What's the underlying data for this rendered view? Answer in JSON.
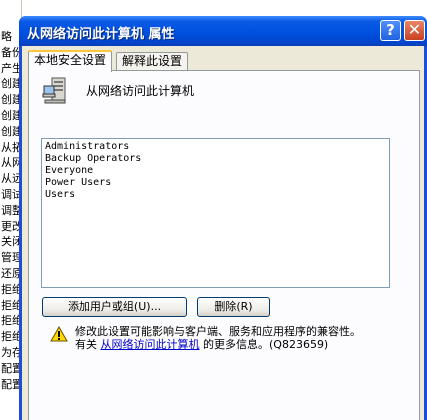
{
  "background_window": {
    "lines": [
      "略",
      "备份",
      "产生",
      "创建",
      "创建",
      "创建",
      "创建",
      "从拓",
      "从网",
      "从远",
      "调试",
      "调整",
      "更改",
      "关闭",
      "管理",
      "还原",
      "拒绝",
      "拒绝",
      "拒绝",
      "拒绝",
      "为存",
      "配置",
      "配置"
    ]
  },
  "dialog": {
    "title": "从网络访问此计算机 属性",
    "help_glyph": "?",
    "close_glyph": "✕"
  },
  "tabs": [
    {
      "label": "本地安全设置",
      "active": true
    },
    {
      "label": "解释此设置",
      "active": false
    }
  ],
  "policy": {
    "icon": "policy-server-icon",
    "title": "从网络访问此计算机"
  },
  "members": [
    "Administrators",
    "Backup Operators",
    "Everyone",
    "Power Users",
    "Users"
  ],
  "buttons": {
    "add": "添加用户或组(U)...",
    "remove": "删除(R)"
  },
  "warning": {
    "icon": "warning-icon",
    "line1": "修改此设置可能影响与客户端、服务和应用程序的兼容性。",
    "line2_prefix": "有关 ",
    "link": "从网络访问此计算机",
    "line2_suffix": " 的更多信息。(Q823659)"
  },
  "colors": {
    "titlebar": "#0050df",
    "window_face": "#ece9d8",
    "tab_highlight": "#ffc83c",
    "link": "#0000cc"
  }
}
